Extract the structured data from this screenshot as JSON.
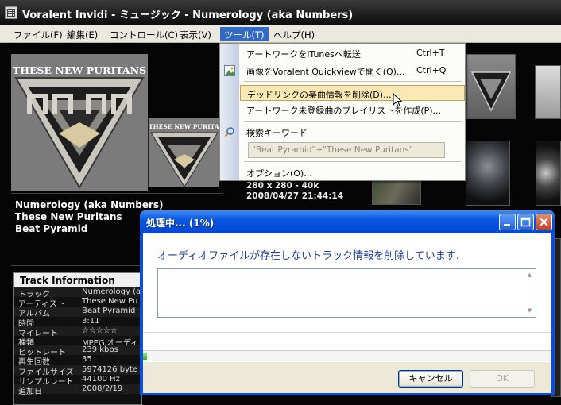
{
  "window": {
    "title": "Voralent Invidi - ミュージック - Numerology (aka Numbers)"
  },
  "menubar": {
    "items": [
      "ファイル(F)",
      "編集(E)",
      "コントロール(C)",
      "表示(V)",
      "ツール(T)",
      "ヘルプ(H)"
    ]
  },
  "tools_menu": {
    "items": [
      {
        "label": "アートワークをiTunesへ転送",
        "shortcut": "Ctrl+T"
      },
      {
        "label": "画像をVoralent Quickviewで開く(Q)...",
        "shortcut": "Ctrl+Q"
      },
      {
        "label": "デッドリンクの楽曲情報を削除(D)...",
        "shortcut": ""
      },
      {
        "label": "アートワーク未登録曲のプレイリストを作成(P)...",
        "shortcut": ""
      },
      {
        "label": "検索キーワード",
        "shortcut": ""
      },
      {
        "label": "オプション(O)...",
        "shortcut": ""
      }
    ],
    "search_keyword_value": "\"Beat Pyramid\"+\"These New Puritans\""
  },
  "artwork": {
    "band_text": "THESE NEW PURITANS"
  },
  "now_playing": {
    "track": "Numerology (aka Numbers)",
    "artist": "These New Puritans",
    "album": "Beat Pyramid"
  },
  "image_info": {
    "size": "280 x 280 - 40k",
    "date": "2008/04/27 21:44:14"
  },
  "track_info": {
    "header": "Track Information",
    "rows": [
      {
        "key": "トラック",
        "value": "Numerology (a"
      },
      {
        "key": "アーティスト",
        "value": "These New Pu"
      },
      {
        "key": "アルバム",
        "value": "Beat Pyramid"
      },
      {
        "key": "時間",
        "value": "3:11"
      },
      {
        "key": "マイレート",
        "value": "☆☆☆☆☆"
      },
      {
        "key": "種類",
        "value": "MPEG オーディ"
      },
      {
        "key": "ビットレート",
        "value": "239 kbps"
      },
      {
        "key": "再生回数",
        "value": "35"
      },
      {
        "key": "ファイルサイズ",
        "value": "5974126 byte"
      },
      {
        "key": "サンプルレート",
        "value": "44100 Hz"
      },
      {
        "key": "追加日",
        "value": "2008/2/19"
      }
    ]
  },
  "progress_dialog": {
    "title": "処理中... (1%)",
    "message": "オーディオファイルが存在しないトラック情報を削除しています.",
    "progress_percent": 1,
    "cancel_label": "キャンセル",
    "ok_label": "OK"
  },
  "colors": {
    "menu_highlight": "#316ac5",
    "dialog_title": "#0a56df",
    "progress_fill": "#2bb11e",
    "message_text": "#1e3c9c"
  }
}
